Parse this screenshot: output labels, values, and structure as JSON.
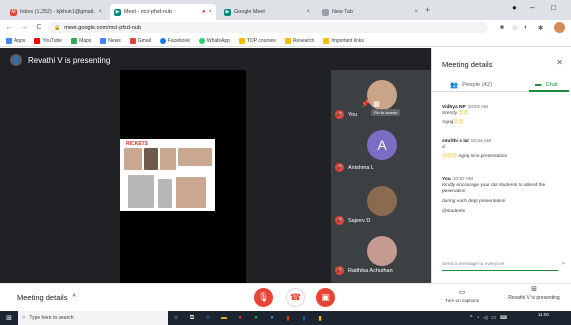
{
  "browser": {
    "tabs": [
      {
        "title": "Inbox (1,252) - kjkhuk1@gmail.c",
        "icon": "gmail-icon",
        "color": "#ea4335",
        "active": false,
        "indicator": ""
      },
      {
        "title": "Meet - mci-pfsd-nub",
        "icon": "meet-icon",
        "color": "#00897b",
        "active": true,
        "indicator": "●"
      },
      {
        "title": "Google Meet",
        "icon": "meet-icon",
        "color": "#00897b",
        "active": false,
        "indicator": ""
      },
      {
        "title": "New Tab",
        "icon": "new-tab-icon",
        "color": "#9aa0a6",
        "active": false,
        "indicator": ""
      }
    ],
    "new_tab_label": "+",
    "window_controls": {
      "minimize": "–",
      "maximize": "□"
    },
    "nav": {
      "back": "←",
      "forward": "→",
      "reload": "C"
    },
    "url": "meet.google.com/mci-pfsd-nub",
    "bookmarks": [
      {
        "label": "Apps",
        "color": "#4285f4"
      },
      {
        "label": "YouTube",
        "color": "#ff0000"
      },
      {
        "label": "Maps",
        "color": "#34a853"
      },
      {
        "label": "News",
        "color": "#4285f4"
      },
      {
        "label": "Gmail",
        "color": "#ea4335"
      },
      {
        "label": "Facebook",
        "color": "#1877f2"
      },
      {
        "label": "WhatsApp",
        "color": "#25d366"
      },
      {
        "label": "TOP courses",
        "color": "#fbbc04"
      },
      {
        "label": "Research",
        "color": "#fbbc04"
      },
      {
        "label": "Important links",
        "color": "#fbbc04"
      }
    ]
  },
  "meet": {
    "presenter_banner": "Revathi V is presenting",
    "slide_title": "RICKETS",
    "participants": [
      {
        "name": "You",
        "avatar_type": "photo"
      },
      {
        "name": "Anishma L",
        "avatar_type": "letter",
        "letter": "A"
      },
      {
        "name": "Sajeev D",
        "avatar_type": "photo"
      },
      {
        "name": "Radhika Achuthan",
        "avatar_type": "photo"
      }
    ],
    "tooltip": "Pin to screen",
    "meeting_details_label": "Meeting details",
    "captions_label": "Turn on captions",
    "presenting_label": "Revathi V is presenting"
  },
  "panel": {
    "title": "Meeting details",
    "close": "✕",
    "tabs": {
      "people": "People (42)",
      "chat": "Chat"
    },
    "messages": [
      {
        "sender": "Vidhya NP",
        "time": "10:53 AM",
        "lines": [
          "Sremfy ",
          "Agraj"
        ],
        "emojis": [
          "😊😊",
          "😊😊"
        ]
      },
      {
        "sender": "smrithi s lal",
        "time": "10:54 AM",
        "lines": [
          "d.",
          "Agraj nice presentation"
        ],
        "emojis": [
          "",
          "😊😊😊"
        ]
      },
      {
        "sender": "You",
        "time": "10:57 AM",
        "lines": [
          "Kindly encourage your dot students to attend the pesenation",
          "during each dept presentation",
          "@students"
        ],
        "emojis": [
          "",
          "",
          ""
        ]
      }
    ],
    "compose_placeholder": "Send a message to everyone",
    "send_icon": "➤"
  },
  "taskbar": {
    "search_placeholder": "Type here to search",
    "time": "11:00"
  },
  "colors": {
    "meet_dark": "#202124",
    "tile_bg": "#3c4043",
    "mic_off_red": "#ea4335",
    "chat_green": "#1e8e3e"
  }
}
